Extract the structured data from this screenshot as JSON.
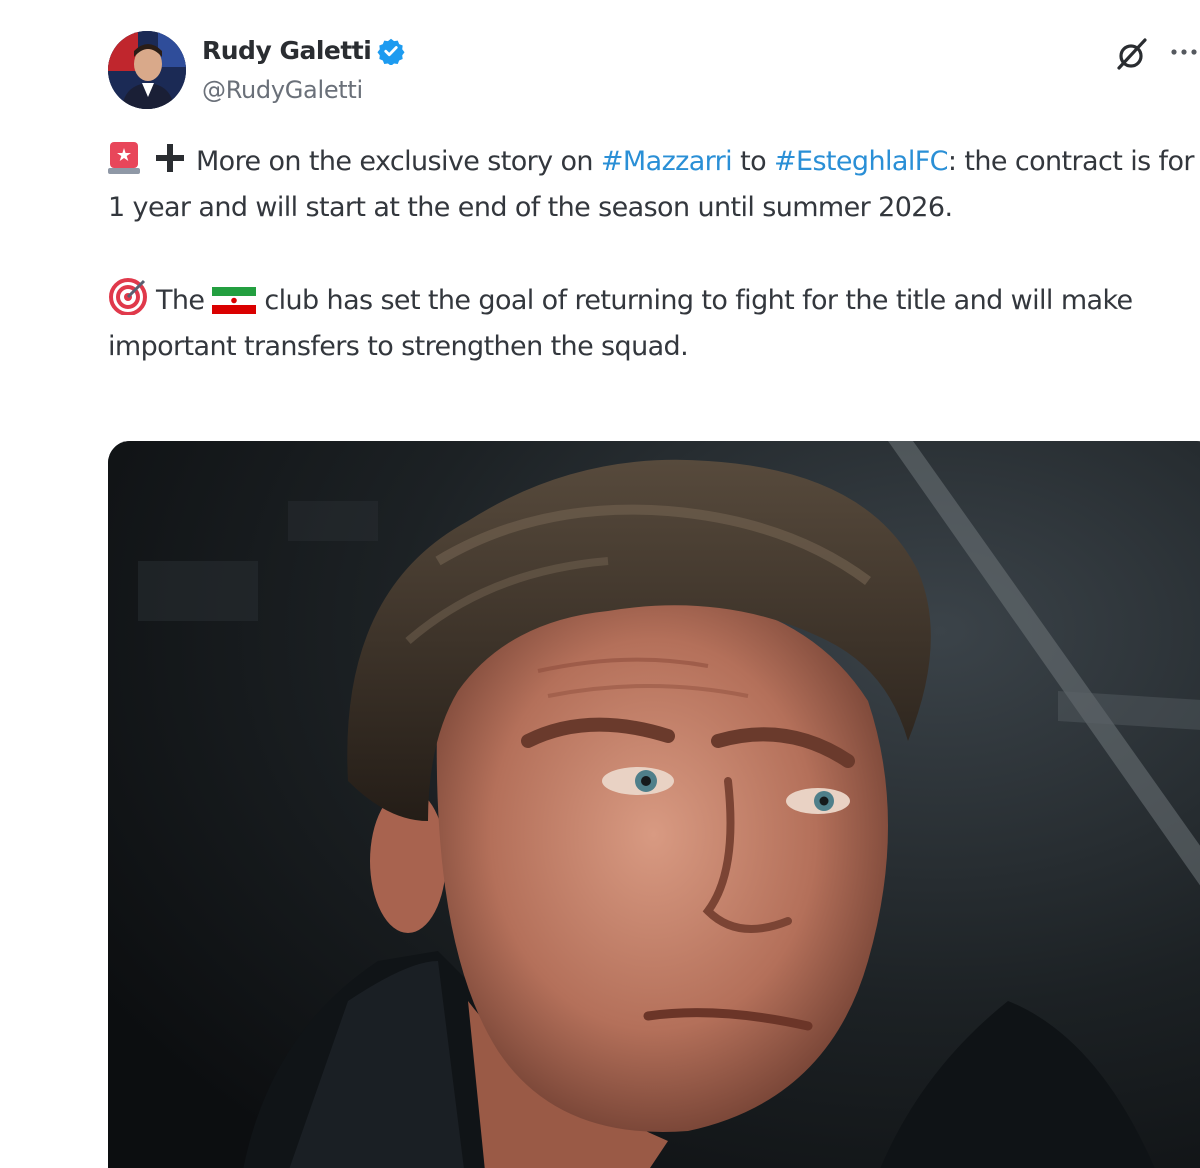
{
  "tweet": {
    "author": {
      "name": "Rudy Galetti",
      "handle": "@RudyGaletti",
      "verified": true,
      "avatar_icon": "avatar-photo"
    },
    "icons": {
      "grok": "grok-icon",
      "more": "more-options-icon"
    },
    "paragraph1": {
      "emoji": "siren-icon",
      "plus": "plus-icon",
      "lead": " More on the exclusive story on ",
      "hashtag1": "#Mazzarri",
      "middle": " to ",
      "hashtag2": "#EsteghlalFC",
      "rest": ": the contract is for 1 year and will start at the end of the season until summer 2026."
    },
    "paragraph2": {
      "emoji": "direct-hit-icon",
      "word_the": " The ",
      "flag": "iran-flag-icon",
      "rest": " club has set the goal of returning to fight for the title and will make important transfers to strengthen the squad."
    },
    "media": {
      "type": "photo",
      "subject": "portrait of a man in a dark coat against a dark stadium background"
    },
    "colors": {
      "link": "#2a8fd6",
      "verified": "#1d9bf0",
      "text": "#33373d",
      "handle": "#6a7079"
    }
  }
}
